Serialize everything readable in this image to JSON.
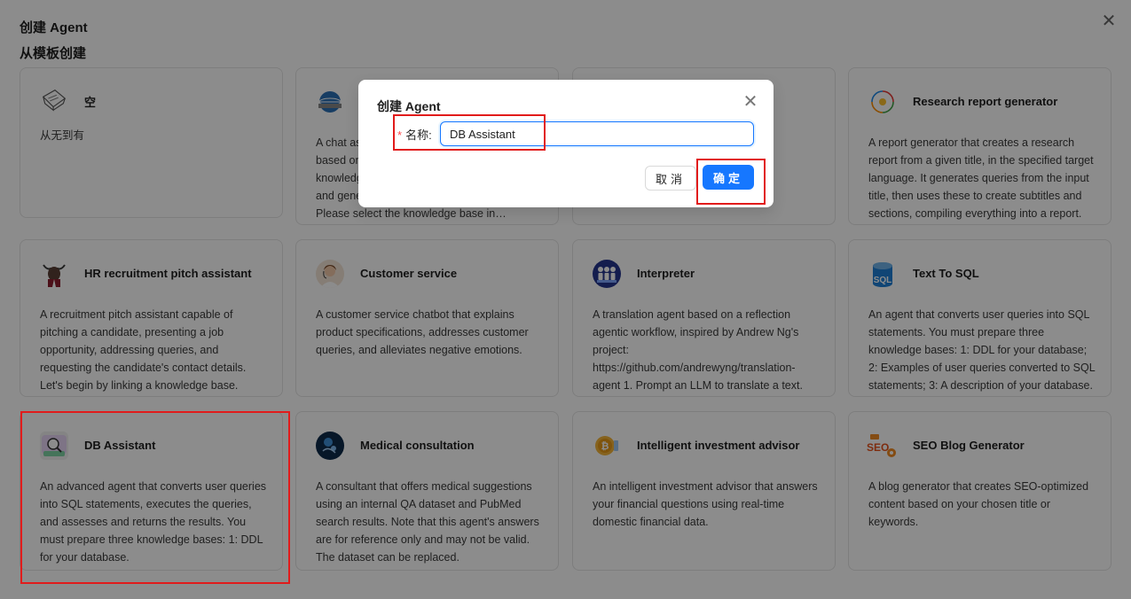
{
  "page": {
    "title": "创建 Agent",
    "section_title": "从模板创建",
    "close_glyph": "✕"
  },
  "templates": [
    {
      "title": "空",
      "desc": "从无到有",
      "icon": "blank-doc-icon"
    },
    {
      "title": "",
      "desc": "A chat assistant that answers user questions based on information retrieved from a knowledge base. It uses the knowledge base and generates answers to user queries. Please select the knowledge base in 'Retrieval'!",
      "icon": "globe-icon"
    },
    {
      "title": "",
      "desc": "",
      "icon": "doc-icon"
    },
    {
      "title": "Research report generator",
      "desc": "A report generator that creates a research report from a given title, in the specified target language. It generates queries from the input title, then uses these to create subtitles and sections, compiling everything into a report.",
      "icon": "dots-icon"
    },
    {
      "title": "HR recruitment pitch assistant",
      "desc": "A recruitment pitch assistant capable of pitching a candidate, presenting a job opportunity, addressing queries, and requesting the candidate's contact details. Let's begin by linking a knowledge base.",
      "icon": "bull-icon"
    },
    {
      "title": "Customer service",
      "desc": "A customer service chatbot that explains product specifications, addresses customer queries, and alleviates negative emotions.",
      "icon": "agent-avatar-icon"
    },
    {
      "title": "Interpreter",
      "desc": "A translation agent based on a reflection agentic workflow, inspired by Andrew Ng's project: https://github.com/andrewyng/translation-agent 1. Prompt an LLM to translate a text.",
      "icon": "people-icon"
    },
    {
      "title": "Text To SQL",
      "desc": "An agent that converts user queries into SQL statements. You must prepare three knowledge bases: 1: DDL for your database; 2: Examples of user queries converted to SQL statements; 3: A description of your database.",
      "icon": "sql-db-icon"
    },
    {
      "title": "DB Assistant",
      "desc": "An advanced agent that converts user queries into SQL statements, executes the queries, and assesses and returns the results. You must prepare three knowledge bases: 1: DDL for your database.",
      "icon": "db-search-icon"
    },
    {
      "title": "Medical consultation",
      "desc": "A consultant that offers medical suggestions using an internal QA dataset and PubMed search results. Note that this agent's answers are for reference only and may not be valid. The dataset can be replaced.",
      "icon": "medical-icon"
    },
    {
      "title": "Intelligent investment advisor",
      "desc": "An intelligent investment advisor that answers your financial questions using real-time domestic financial data.",
      "icon": "coin-icon"
    },
    {
      "title": "SEO Blog Generator",
      "desc": "A blog generator that creates SEO-optimized content based on your chosen title or keywords.",
      "icon": "seo-icon"
    }
  ],
  "sql_icon_text": "SQL",
  "seo_icon_text": "SEO",
  "dialog": {
    "title": "创建 Agent",
    "required_mark": "*",
    "name_label": "名称:",
    "name_value": "DB Assistant",
    "cancel_label": "取消",
    "ok_label": "确定",
    "close_glyph": "✕"
  },
  "colors": {
    "primary": "#1677ff",
    "highlight": "#e11b1b",
    "required": "#ff4d4f"
  }
}
